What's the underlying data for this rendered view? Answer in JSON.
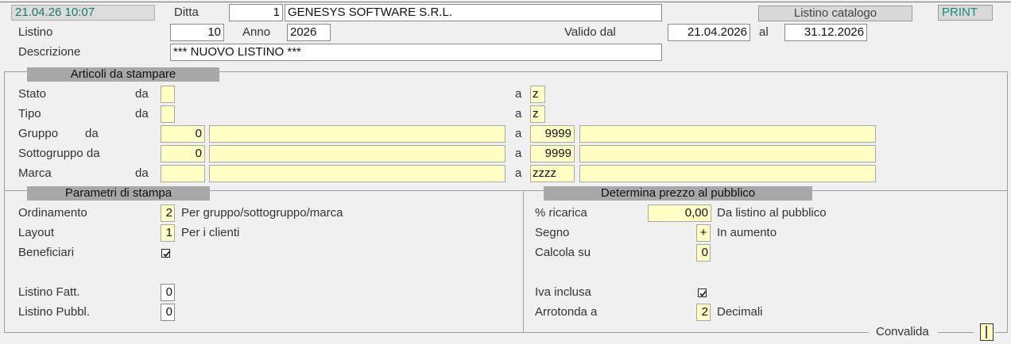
{
  "header": {
    "datetime": "21.04.26 10:07",
    "ditta_label": "Ditta",
    "ditta_code": "1",
    "ditta_name": "GENESYS SOFTWARE S.R.L.",
    "mode_label": "Listino catalogo",
    "print_button": "PRINT"
  },
  "listino": {
    "listino_label": "Listino",
    "listino_value": "10",
    "anno_label": "Anno",
    "anno_value": "2026",
    "valido_dal_label": "Valido dal",
    "valido_dal_value": "21.04.2026",
    "al_label": "al",
    "al_value": "31.12.2026",
    "descrizione_label": "Descrizione",
    "descrizione_value": "*** NUOVO LISTINO ***"
  },
  "articoli": {
    "section_title": "Articoli da stampare",
    "da_label": "da",
    "a_label": "a",
    "stato_label": "Stato",
    "stato_from": "",
    "stato_to": "z",
    "tipo_label": "Tipo",
    "tipo_from": "",
    "tipo_to": "z",
    "gruppo_label": "Gruppo",
    "gruppo_from_code": "0",
    "gruppo_from_desc": "",
    "gruppo_to_code": "9999",
    "gruppo_to_desc": "",
    "sottogruppo_label": "Sottogruppo da",
    "sottogruppo_from_code": "0",
    "sottogruppo_from_desc": "",
    "sottogruppo_to_code": "9999",
    "sottogruppo_to_desc": "",
    "marca_label": "Marca",
    "marca_from_code": "",
    "marca_from_desc": "",
    "marca_to_code": "zzzz",
    "marca_to_desc": ""
  },
  "parametri": {
    "section_title": "Parametri di stampa",
    "ordinamento_label": "Ordinamento",
    "ordinamento_value": "2",
    "ordinamento_desc": "Per gruppo/sottogruppo/marca",
    "layout_label": "Layout",
    "layout_value": "1",
    "layout_desc": "Per i clienti",
    "beneficiari_label": "Beneficiari",
    "beneficiari_checked": true,
    "listino_fatt_label": "Listino Fatt.",
    "listino_fatt_value": "0",
    "listino_pubbl_label": "Listino Pubbl.",
    "listino_pubbl_value": "0"
  },
  "prezzo": {
    "section_title": "Determina prezzo al pubblico",
    "ricarica_label": "% ricarica",
    "ricarica_value": "0,00",
    "ricarica_desc": "Da listino al pubblico",
    "segno_label": "Segno",
    "segno_value": "+",
    "segno_desc": "In aumento",
    "calcola_label": "Calcola su",
    "calcola_value": "0",
    "iva_label": "Iva inclusa",
    "iva_checked": true,
    "arrotonda_label": "Arrotonda a",
    "arrotonda_value": "2",
    "arrotonda_desc": "Decimali"
  },
  "footer": {
    "convalida_label": "Convalida"
  }
}
